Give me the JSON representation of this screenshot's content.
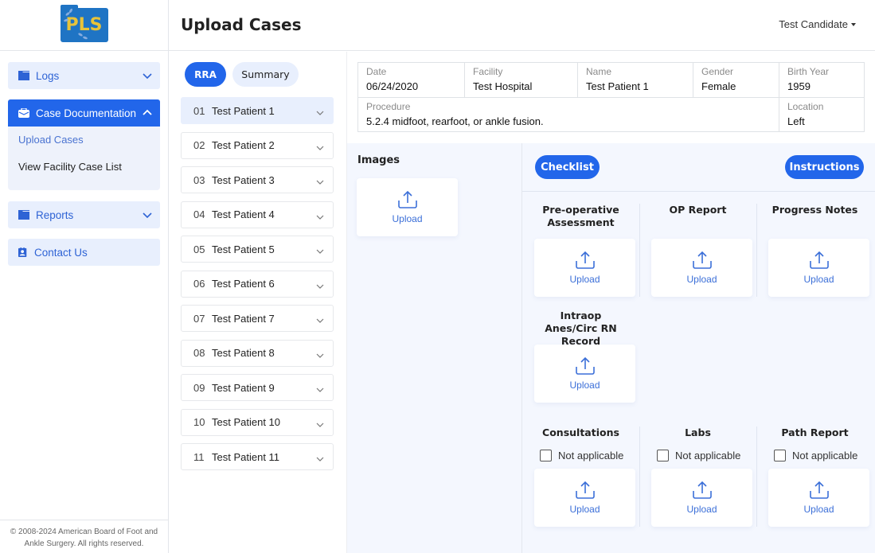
{
  "sidebar": {
    "logo_text": "PLS",
    "nav": [
      {
        "label": "Logs",
        "icon": "folder-icon",
        "expanded": false
      },
      {
        "label": "Case Documentation",
        "icon": "briefcase-icon",
        "expanded": true,
        "children": [
          {
            "label": "Upload Cases",
            "current": true
          },
          {
            "label": "View Facility Case List",
            "current": false
          }
        ]
      },
      {
        "label": "Reports",
        "icon": "folder-icon",
        "expanded": false
      },
      {
        "label": "Contact Us",
        "icon": "contact-icon"
      }
    ],
    "footer": "© 2008-2024 American Board of Foot and Ankle Surgery. All rights reserved."
  },
  "header": {
    "title": "Upload Cases",
    "user": "Test Candidate"
  },
  "tabs": {
    "rra": "RRA",
    "summary": "Summary",
    "active": "RRA"
  },
  "patients": [
    {
      "num": "01",
      "name": "Test Patient 1",
      "selected": true
    },
    {
      "num": "02",
      "name": "Test Patient 2"
    },
    {
      "num": "03",
      "name": "Test Patient 3"
    },
    {
      "num": "04",
      "name": "Test Patient 4"
    },
    {
      "num": "05",
      "name": "Test Patient 5"
    },
    {
      "num": "06",
      "name": "Test Patient 6"
    },
    {
      "num": "07",
      "name": "Test Patient 7"
    },
    {
      "num": "08",
      "name": "Test Patient 8"
    },
    {
      "num": "09",
      "name": "Test Patient 9"
    },
    {
      "num": "10",
      "name": "Test Patient 10"
    },
    {
      "num": "11",
      "name": "Test Patient 11"
    }
  ],
  "case_info": {
    "date": {
      "label": "Date",
      "value": "06/24/2020"
    },
    "facility": {
      "label": "Facility",
      "value": "Test Hospital"
    },
    "name": {
      "label": "Name",
      "value": "Test Patient 1"
    },
    "gender": {
      "label": "Gender",
      "value": "Female"
    },
    "birth_year": {
      "label": "Birth Year",
      "value": "1959"
    },
    "procedure": {
      "label": "Procedure",
      "value": "5.2.4 midfoot, rearfoot, or ankle fusion."
    },
    "location": {
      "label": "Location",
      "value": "Left"
    }
  },
  "images": {
    "title": "Images",
    "upload_label": "Upload"
  },
  "buttons": {
    "checklist": "Checklist",
    "instructions": "Instructions"
  },
  "documents": [
    {
      "title": "Pre-operative Assessment",
      "upload_label": "Upload"
    },
    {
      "title": "OP Report",
      "upload_label": "Upload"
    },
    {
      "title": "Progress Notes",
      "upload_label": "Upload"
    },
    {
      "title": "Intraop Anes/Circ RN Record",
      "upload_label": "Upload"
    },
    {
      "title": "Consultations",
      "upload_label": "Upload",
      "not_applicable_label": "Not applicable",
      "not_applicable": false
    },
    {
      "title": "Labs",
      "upload_label": "Upload",
      "not_applicable_label": "Not applicable",
      "not_applicable": false
    },
    {
      "title": "Path Report",
      "upload_label": "Upload",
      "not_applicable_label": "Not applicable",
      "not_applicable": false
    }
  ],
  "colors": {
    "primary": "#2266ea",
    "light": "#e8effd",
    "logo_blue": "#1f74c4",
    "logo_yellow": "#e8c33a"
  }
}
